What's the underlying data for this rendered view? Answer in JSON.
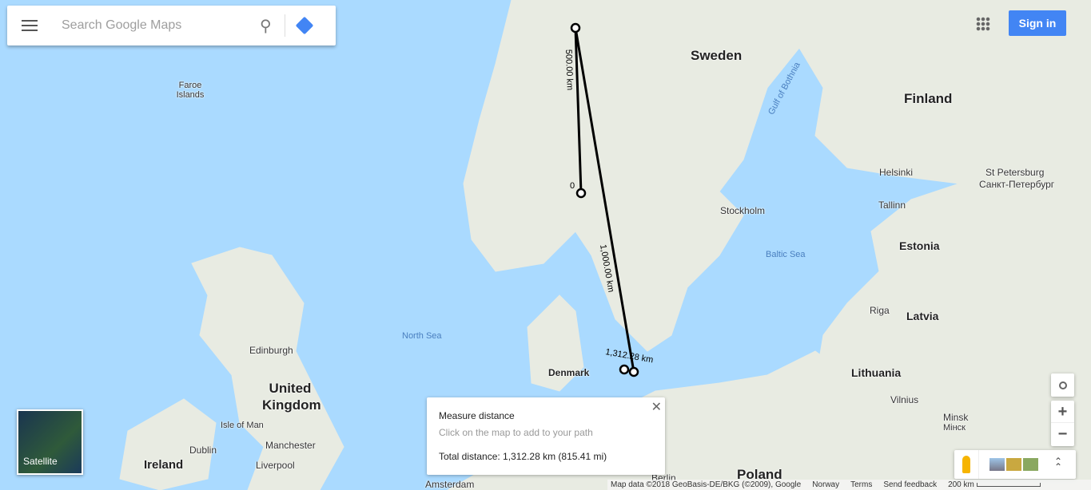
{
  "search": {
    "placeholder": "Search Google Maps",
    "menu_icon": "hamburger-icon",
    "search_icon": "magnifier-icon",
    "directions_icon": "directions-icon"
  },
  "header": {
    "apps_icon": "apps-grid-icon",
    "sign_in": "Sign in",
    "accent": "#4285f4"
  },
  "labels": {
    "countries": [
      {
        "name": "Sweden"
      },
      {
        "name": "Finland"
      },
      {
        "name": "Estonia"
      },
      {
        "name": "Latvia"
      },
      {
        "name": "Lithuania"
      },
      {
        "name": "Denmark"
      },
      {
        "name": "United Kingdom"
      },
      {
        "name": "Ireland"
      },
      {
        "name": "Poland"
      }
    ],
    "seas": [
      {
        "name": "North Sea"
      },
      {
        "name": "Baltic Sea"
      },
      {
        "name": "Gulf of Bothnia"
      }
    ],
    "places": [
      {
        "name": "Faroe Islands"
      },
      {
        "name": "Helsinki"
      },
      {
        "name": "St Petersburg"
      },
      {
        "name": "Санкт-Петербург"
      },
      {
        "name": "Tallinn"
      },
      {
        "name": "Stockholm"
      },
      {
        "name": "Riga"
      },
      {
        "name": "Vilnius"
      },
      {
        "name": "Minsk"
      },
      {
        "name": "Мінск"
      },
      {
        "name": "Edinburgh"
      },
      {
        "name": "Isle of Man"
      },
      {
        "name": "Dublin"
      },
      {
        "name": "Manchester"
      },
      {
        "name": "Liverpool"
      },
      {
        "name": "Berlin"
      },
      {
        "name": "Amsterdam"
      }
    ]
  },
  "measure_path": {
    "segment_labels": [
      "0",
      "500.00 km",
      "1,000.00 km",
      "1,312.28 km"
    ],
    "line_color": "#000000"
  },
  "measure_panel": {
    "title": "Measure distance",
    "hint": "Click on the map to add to your path",
    "total": "Total distance: 1,312.28 km (815.41 mi)",
    "close_icon": "close-icon"
  },
  "layer_toggle": {
    "label": "Satellite"
  },
  "controls": {
    "location_icon": "my-location-icon",
    "zoom_in": "+",
    "zoom_out": "−",
    "pegman_icon": "pegman-icon",
    "imagery_icon": "imagery-thumbnails",
    "expand_icon": "chevron-double-up-icon"
  },
  "footer": {
    "map_data": "Map data ©2018 GeoBasis-DE/BKG (©2009), Google",
    "region": "Norway",
    "terms": "Terms",
    "feedback": "Send feedback",
    "scale": "200 km"
  }
}
